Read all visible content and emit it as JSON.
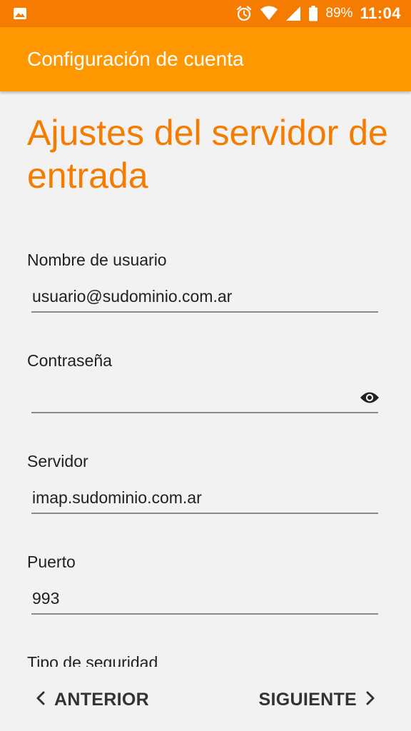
{
  "status_bar": {
    "battery_percent": "89%",
    "time": "11:04",
    "icons": [
      "image-icon",
      "alarm-icon",
      "wifi-icon",
      "signal-icon",
      "battery-icon"
    ],
    "background_color": "#f57c00"
  },
  "app_bar": {
    "title": "Configuración de cuenta",
    "background_color": "#ff9800"
  },
  "page": {
    "heading": "Ajustes del servidor de entrada",
    "heading_color": "#f57c00"
  },
  "form": {
    "username": {
      "label": "Nombre de usuario",
      "value": "usuario@sudominio.com.ar"
    },
    "password": {
      "label": "Contraseña",
      "value": ""
    },
    "server": {
      "label": "Servidor",
      "value": "imap.sudominio.com.ar"
    },
    "port": {
      "label": "Puerto",
      "value": "993"
    },
    "security": {
      "label": "Tipo de seguridad"
    }
  },
  "navigation": {
    "previous_label": "ANTERIOR",
    "next_label": "SIGUIENTE"
  }
}
